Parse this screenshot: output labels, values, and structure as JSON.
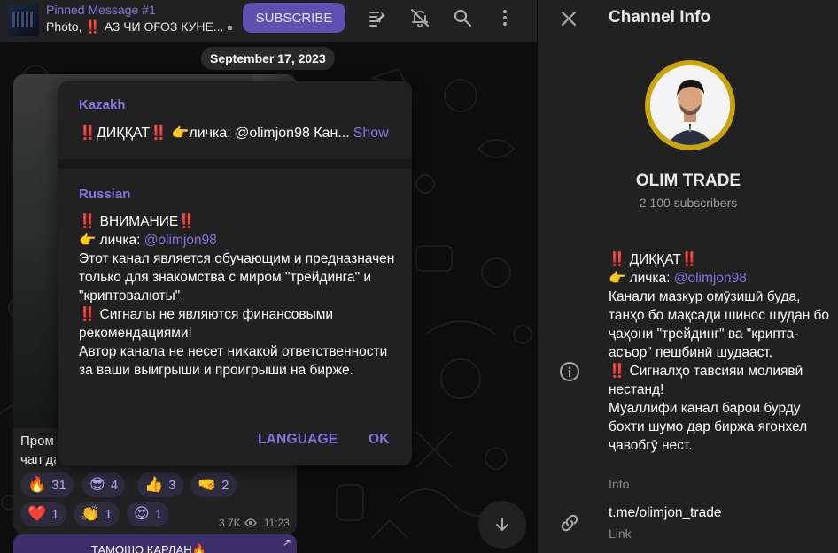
{
  "colors": {
    "accent": "#8774e1",
    "panel": "#212121",
    "avatar_ring": "#c9a40a"
  },
  "header": {
    "pinned_title": "Pinned Message #1",
    "pinned_text_prefix": "Photo, ",
    "pinned_text_emoji": "‼️",
    "pinned_text": " АЗ ЧИ ОҒОЗ КУНЕ...",
    "subscribe_label": "SUBSCRIBE",
    "icons": [
      "pinned-list-icon",
      "mute-icon",
      "search-icon",
      "more-icon"
    ]
  },
  "chat": {
    "date": "September 17, 2023",
    "message_text_line1": "Пром",
    "message_text_line2": "чап да",
    "reactions": [
      {
        "emoji": "🔥",
        "count": "31"
      },
      {
        "emoji": "😎",
        "count": "4"
      },
      {
        "emoji": "👍",
        "count": "3"
      },
      {
        "emoji": "🤜",
        "count": "2"
      },
      {
        "emoji": "❤️",
        "count": "1"
      },
      {
        "emoji": "👏",
        "count": "1"
      },
      {
        "emoji": "😍",
        "count": "1"
      }
    ],
    "views": "3.7K",
    "time": "11:23",
    "next_message": "ТАМОШО КАРДАН🔥"
  },
  "popup": {
    "kazakh_label": "Kazakh",
    "kazakh_text": "‼️ДИҚҚАТ‼️ 👉личка: @olimjon98 Кан...",
    "show_label": "Show",
    "russian_label": "Russian",
    "ru_line1": "‼️ ВНИМАНИЕ‼️",
    "ru_line2_prefix": "👉 личка: ",
    "ru_line2_link": "@olimjon98",
    "ru_line3": "Этот канал является обучающим и предназначен только для знакомства с миром \"трейдинга\" и \"криптовалюты\".",
    "ru_line4": "‼️ Сигналы не являются финансовыми рекомендациями!",
    "ru_line5": "Автор канала не несет никакой ответственности за ваши выигрыши и проигрыши на бирже.",
    "language_button": "LANGUAGE",
    "ok_button": "OK"
  },
  "info": {
    "title": "Channel Info",
    "channel_name": "OLIM TRADE",
    "subscribers": "2 100 subscribers",
    "desc_line1": "‼️ ДИҚҚАТ‼️",
    "desc_line2_prefix": "👉 личка: ",
    "desc_line2_link": "@olimjon98",
    "desc_line3": "Канали мазкур омӯзишӣ буда, танҳо бо мақсади шинос шудан бо ҷаҳони \"трейдинг\" ва \"крипта-асъор\" пешбинӣ шудааст.",
    "desc_line4": "‼️ Сигналҳо тавсияи молиявӣ нестанд!",
    "desc_line5": "Муаллифи канал барои бурду бохти шумо дар биржа ягонхел ҷавобгӯ нест.",
    "info_label": "Info",
    "link_value": "t.me/olimjon_trade",
    "link_label": "Link"
  }
}
